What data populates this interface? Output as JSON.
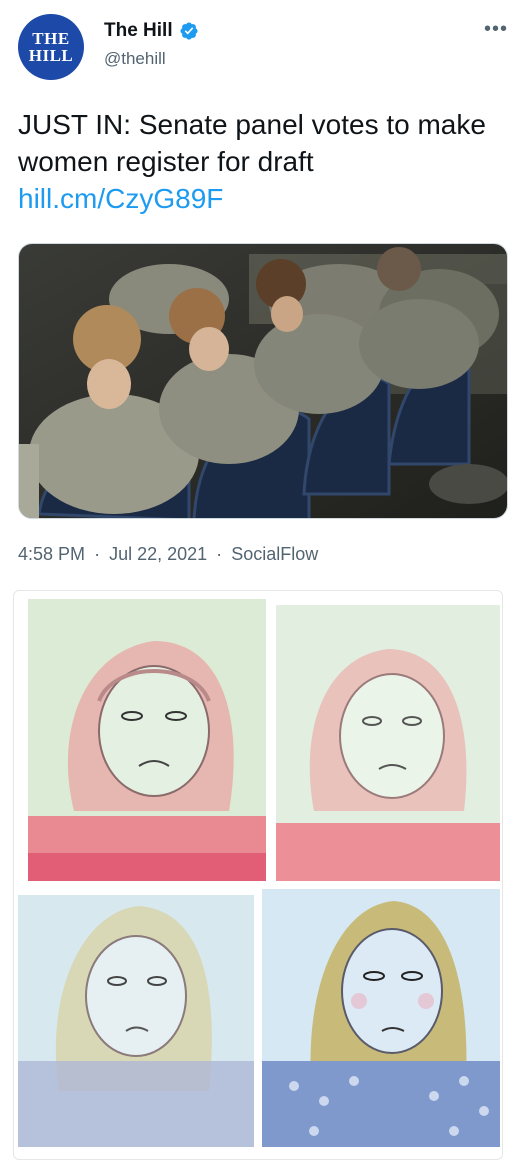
{
  "account": {
    "avatar_line1": "THE",
    "avatar_line2": "HILL",
    "name": "The Hill",
    "handle": "@thehill",
    "more_label": "•••"
  },
  "tweet": {
    "text": "JUST IN: Senate panel votes to make women register for draft",
    "link": "hill.cm/CzyG89F"
  },
  "meta": {
    "time": "4:58 PM",
    "separator1": "·",
    "date": "Jul 22, 2021",
    "separator2": "·",
    "source": "SocialFlow"
  },
  "colors": {
    "link": "#1d9bf0",
    "avatar_bg": "#1d4aa8",
    "verified": "#1d9bf0",
    "meta_text": "#536471"
  },
  "icons": {
    "verified": "verified-badge-icon",
    "more": "more-options-icon"
  }
}
